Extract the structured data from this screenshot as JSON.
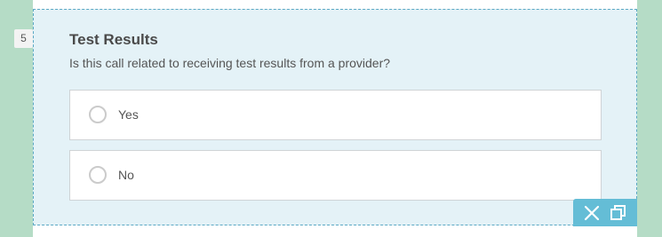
{
  "question": {
    "number": "5",
    "title": "Test Results",
    "description": "Is this call related to receiving test results from a provider?",
    "choices": [
      {
        "label": "Yes",
        "selected": false
      },
      {
        "label": "No",
        "selected": false
      }
    ]
  },
  "toolbar": {
    "buttons": [
      {
        "icon": "close-icon"
      },
      {
        "icon": "duplicate-icon"
      }
    ]
  },
  "colors": {
    "background_side": "#b5dcc6",
    "card_fill": "#e4f2f7",
    "card_border": "#5aa8c4",
    "toolbar_fill": "#64bdd6"
  }
}
